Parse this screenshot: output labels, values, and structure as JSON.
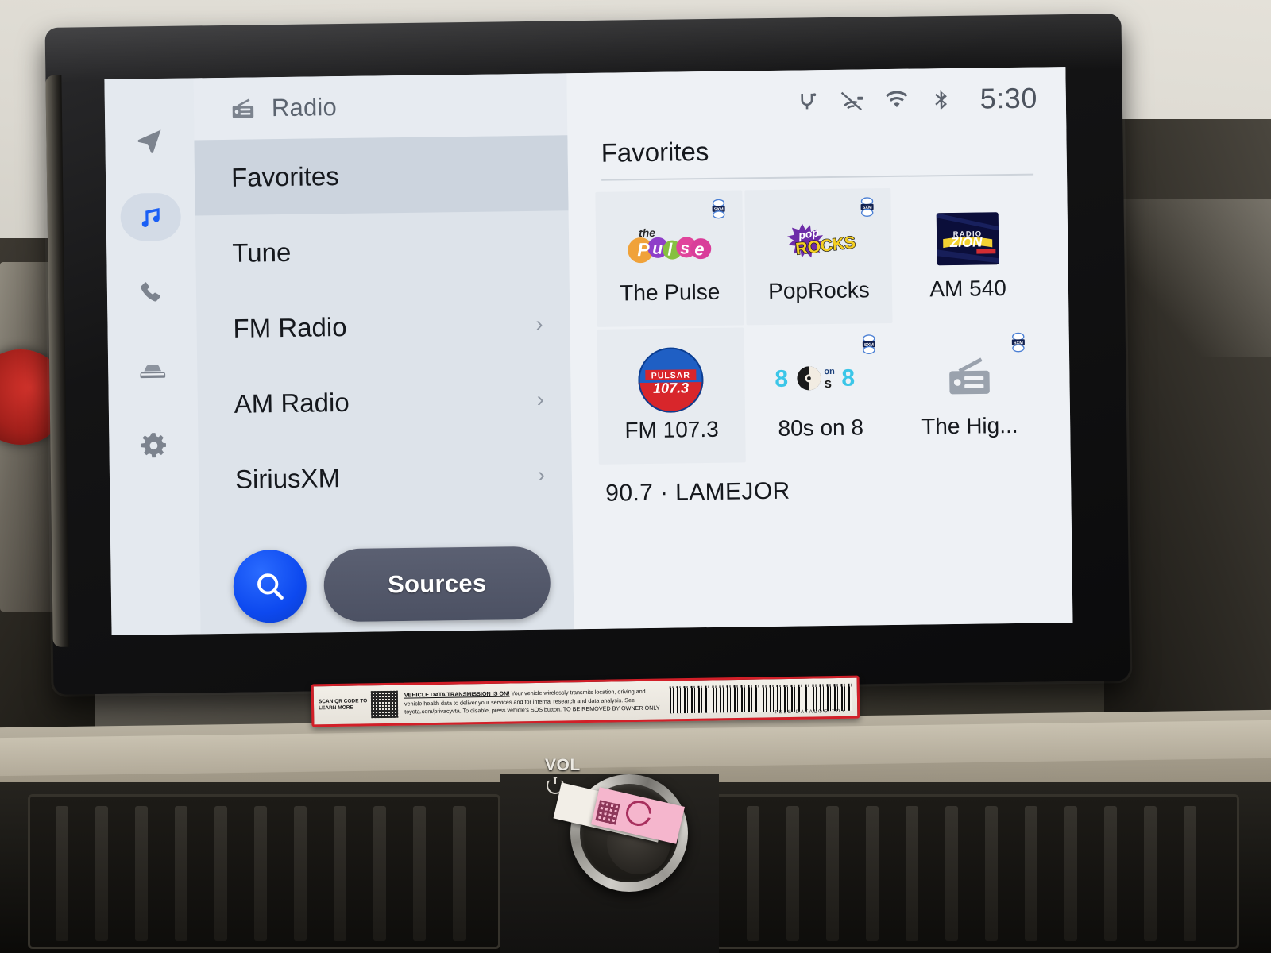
{
  "app": {
    "header": {
      "icon": "radio-icon",
      "title": "Radio"
    },
    "statusbar": {
      "icons": [
        "qi-wireless-charging-icon",
        "connected-services-off-icon",
        "wifi-icon",
        "bluetooth-icon"
      ],
      "time": "5:30"
    },
    "accent_colors": {
      "search_blue": "#0d49ef",
      "sources_slate": "#4c5163",
      "active_rail": "#1a5ff5",
      "screen_bg": "#eef1f5",
      "list_bg": "#dde3ea",
      "selected_row": "#ccd4de"
    }
  },
  "sidebar": {
    "items": [
      {
        "name": "navigation",
        "icon": "navigation-arrow-icon",
        "active": false
      },
      {
        "name": "media",
        "icon": "music-note-icon",
        "active": true
      },
      {
        "name": "phone",
        "icon": "phone-icon",
        "active": false
      },
      {
        "name": "vehicle",
        "icon": "car-icon",
        "active": false
      },
      {
        "name": "settings",
        "icon": "gear-icon",
        "active": false
      }
    ]
  },
  "menu": {
    "rows": [
      {
        "label": "Favorites",
        "chevron": "",
        "selected": true
      },
      {
        "label": "Tune",
        "chevron": "",
        "selected": false
      },
      {
        "label": "FM Radio",
        "chevron": "›",
        "selected": false
      },
      {
        "label": "AM Radio",
        "chevron": "›",
        "selected": false
      },
      {
        "label": "SiriusXM",
        "chevron": "›",
        "selected": false
      }
    ],
    "search_label": "search-icon",
    "sources_label": "Sources"
  },
  "favorites": {
    "title": "Favorites",
    "tiles": [
      {
        "label": "The Pulse",
        "logo": "the-pulse-logo",
        "sxm_badge": true
      },
      {
        "label": "PopRocks",
        "logo": "poprocks-logo",
        "sxm_badge": true
      },
      {
        "label": "AM 540",
        "logo": "radio-zion-logo",
        "sxm_badge": false
      },
      {
        "label": "FM 107.3",
        "logo": "pulsar-1073-logo",
        "sxm_badge": false
      },
      {
        "label": "80s on 8",
        "logo": "80s-on-8-logo",
        "sxm_badge": true
      },
      {
        "label": "The Hig...",
        "logo": "generic-radio-logo",
        "sxm_badge": true
      }
    ],
    "now_playing": "90.7 · LAMEJOR"
  },
  "vehicle_console": {
    "volume_label": "VOL",
    "sticker": {
      "scan_text": "SCAN QR CODE TO LEARN MORE",
      "headline": "VEHICLE DATA TRANSMISSION IS ON!",
      "body": "Your vehicle wirelessly transmits location, driving and vehicle health data to deliver your services and for internal research and data analysis. See toyota.com/privacyvta. To disable, press vehicle's SOS button.",
      "footer": "TO BE REMOVED BY OWNER ONLY",
      "barcode_label": "TELE   DATALOG   TOY"
    }
  }
}
